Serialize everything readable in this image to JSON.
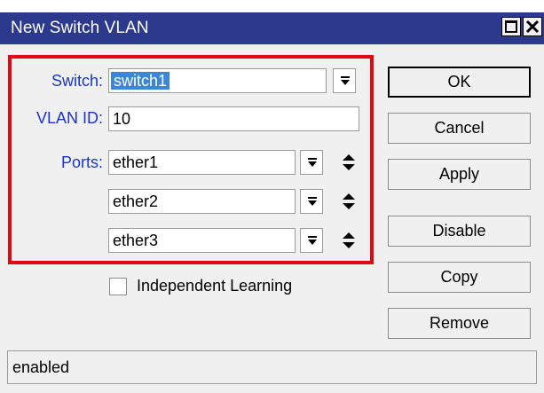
{
  "window": {
    "title": "New Switch VLAN"
  },
  "form": {
    "switch_label": "Switch:",
    "switch_value": "switch1",
    "vlan_id_label": "VLAN ID:",
    "vlan_id_value": "10",
    "ports_label": "Ports:",
    "ports": [
      "ether1",
      "ether2",
      "ether3"
    ],
    "independent_learning_label": "Independent Learning",
    "independent_learning_checked": false
  },
  "buttons": {
    "ok": "OK",
    "cancel": "Cancel",
    "apply": "Apply",
    "disable": "Disable",
    "copy": "Copy",
    "remove": "Remove"
  },
  "status": {
    "text": "enabled"
  },
  "colors": {
    "titlebar": "#2b3a8c",
    "label_blue": "#1a35c9",
    "highlight_red": "#e30613",
    "selection": "#3c86d8"
  },
  "icons": {
    "maximize": "maximize-icon",
    "close": "close-icon",
    "dropdown": "dropdown-arrow-icon",
    "updown": "up-down-icon"
  }
}
